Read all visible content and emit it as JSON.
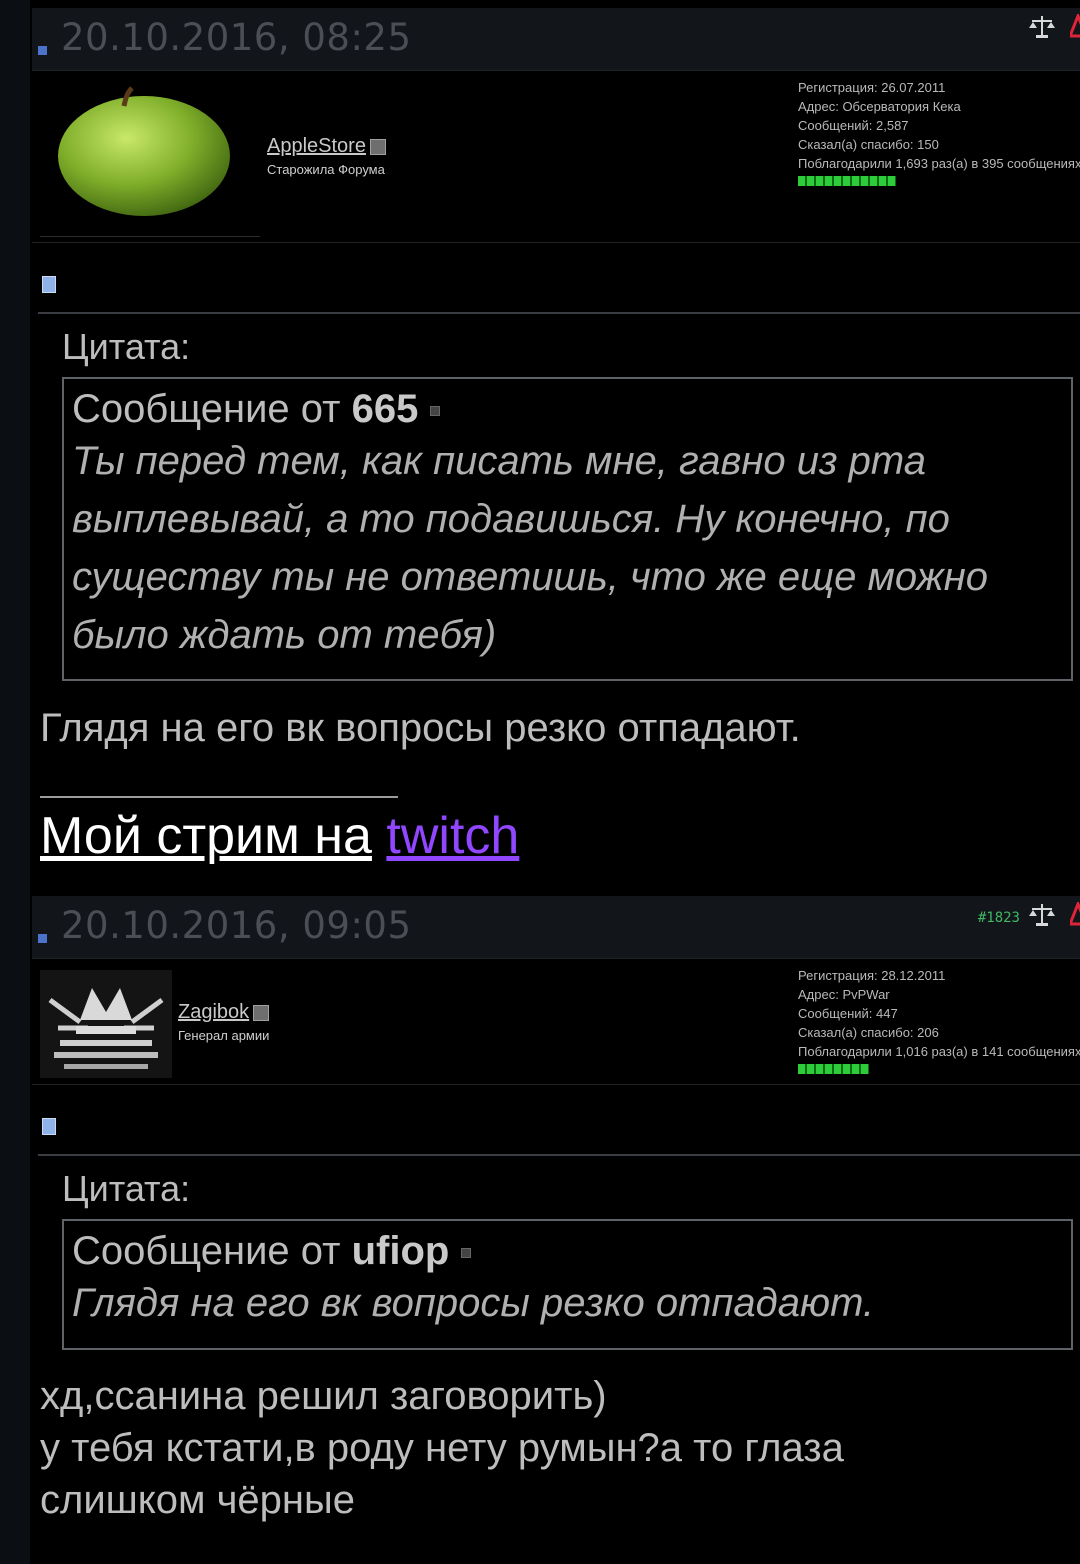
{
  "posts": [
    {
      "date": "20.10.2016, 08:25",
      "number": "",
      "user": {
        "name": "AppleStore",
        "title": "Старожила Форума",
        "stats": {
          "registration": "Регистрация: 26.07.2011",
          "address": "Адрес: Обсерватория Кека",
          "messages": "Сообщений: 2,587",
          "said_thanks": "Сказал(а) спасибо: 150",
          "thanked": "Поблагодарили 1,693 раз(а) в 395 сообщениях"
        },
        "avatar": "green-apple"
      },
      "quote": {
        "label": "Цитата:",
        "from_prefix": "Сообщение от",
        "from_user": "665",
        "text": "Ты перед тем, как писать мне, гавно из рта выплевывай, а то подавишься. Ну конечно, по существу ты не ответишь, что же еще можно было ждать от тебя)"
      },
      "message": "Глядя на его вк вопросы резко отпадают.",
      "signature": {
        "prefix": "Мой стрим на",
        "link": "twitch"
      }
    },
    {
      "date": "20.10.2016, 09:05",
      "number": "#1823",
      "user": {
        "name": "Zagibok",
        "title": "Генерал армии",
        "stats": {
          "registration": "Регистрация: 28.12.2011",
          "address": "Адрес: PvPWar",
          "messages": "Сообщений: 447",
          "said_thanks": "Сказал(а) спасибо: 206",
          "thanked": "Поблагодарили 1,016 раз(а) в 141 сообщениях"
        },
        "avatar": "crown-emblem"
      },
      "quote": {
        "label": "Цитата:",
        "from_prefix": "Сообщение от",
        "from_user": "ufiop",
        "text": "Глядя на его вк вопросы резко отпадают."
      },
      "message_lines": [
        "хд,ссанина решил заговорить)",
        "у тебя кстати,в роду нету румын?а то глаза",
        "слишком чёрные"
      ]
    }
  ],
  "colors": {
    "background": "#000000",
    "header": "#121519",
    "twitch": "#9146ff",
    "reputation": "#2ecb3a",
    "post_number": "#3fb864"
  },
  "icons": [
    "scales-icon",
    "warning-icon",
    "document-icon",
    "online-status-icon",
    "post-dot-icon"
  ]
}
